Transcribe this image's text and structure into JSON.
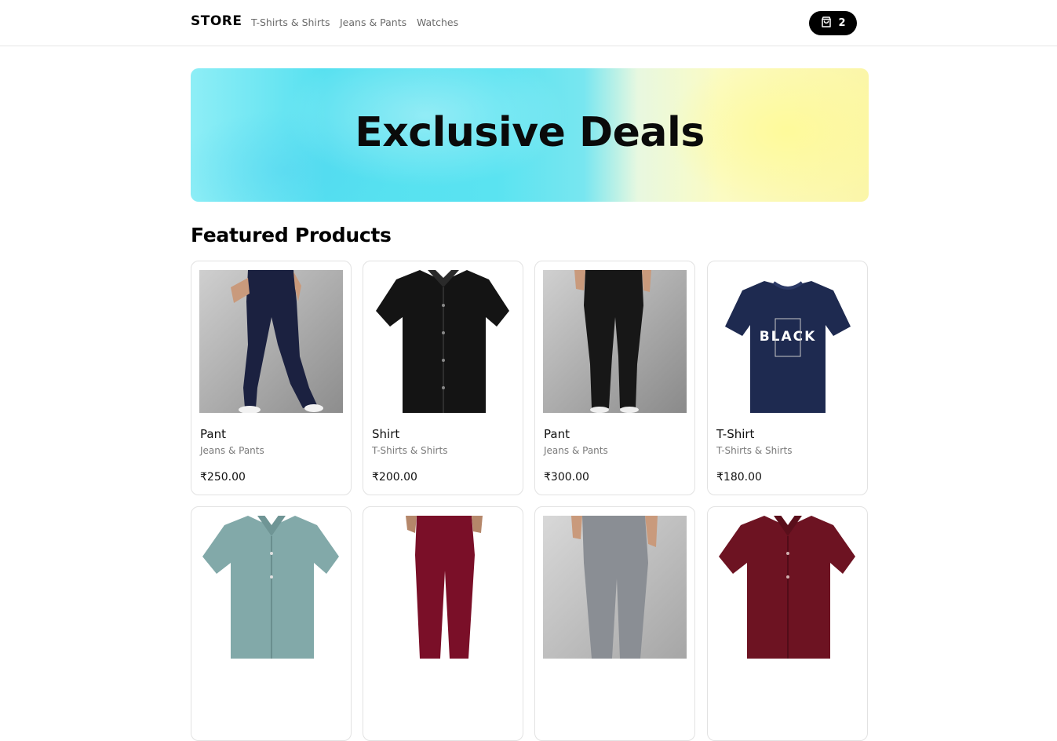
{
  "nav": {
    "brand": "STORE",
    "links": [
      "T-Shirts & Shirts",
      "Jeans & Pants",
      "Watches"
    ],
    "cart_icon": "shopping-bag-icon",
    "cart_count": "2"
  },
  "hero": {
    "title": "Exclusive Deals"
  },
  "featured": {
    "title": "Featured Products",
    "products": [
      {
        "name": "Pant",
        "category": "Jeans & Pants",
        "price": "₹250.00",
        "image": "navy-pants-photo",
        "color": "#1c2340"
      },
      {
        "name": "Shirt",
        "category": "T-Shirts & Shirts",
        "price": "₹200.00",
        "image": "black-shirt-photo",
        "color": "#151515"
      },
      {
        "name": "Pant",
        "category": "Jeans & Pants",
        "price": "₹300.00",
        "image": "black-pants-photo",
        "color": "#1a1a1a"
      },
      {
        "name": "T-Shirt",
        "category": "T-Shirts & Shirts",
        "price": "₹180.00",
        "image": "navy-tshirt-photo",
        "color": "#1e2a4f"
      },
      {
        "name": "",
        "category": "",
        "price": "",
        "image": "teal-shirt-photo",
        "color": "#7fa6a6"
      },
      {
        "name": "",
        "category": "",
        "price": "",
        "image": "maroon-pants-photo",
        "color": "#7a1028"
      },
      {
        "name": "",
        "category": "",
        "price": "",
        "image": "grey-jeans-photo",
        "color": "#8a8e94"
      },
      {
        "name": "",
        "category": "",
        "price": "",
        "image": "maroon-shirt-photo",
        "color": "#6e1422"
      }
    ]
  }
}
